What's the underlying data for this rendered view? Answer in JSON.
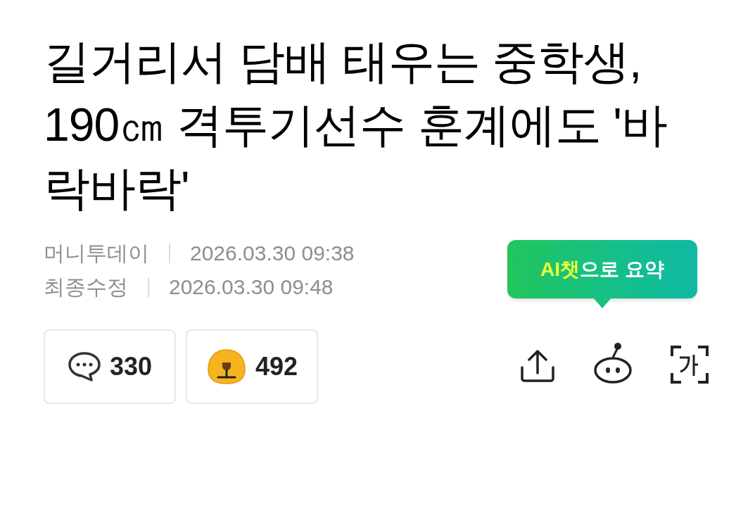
{
  "headline": "길거리서 담배 태우는 중학생, 190㎝ 격투기선수 훈계에도 '바락바락'",
  "meta": [
    {
      "label": "머니투데이",
      "time": "2026.03.30 09:38"
    },
    {
      "label": "최종수정",
      "time": "2026.03.30 09:48"
    }
  ],
  "counters": [
    {
      "kind": "comments",
      "count": "330"
    },
    {
      "kind": "reactions",
      "count": "492"
    }
  ],
  "ai_tooltip": {
    "parts": [
      {
        "text": "AI챗",
        "highlighted": true
      },
      {
        "text": "으로 요약",
        "highlighted": false
      }
    ]
  },
  "actions": [
    {
      "kind": "share"
    },
    {
      "kind": "ai-chat"
    },
    {
      "kind": "font-size"
    }
  ]
}
